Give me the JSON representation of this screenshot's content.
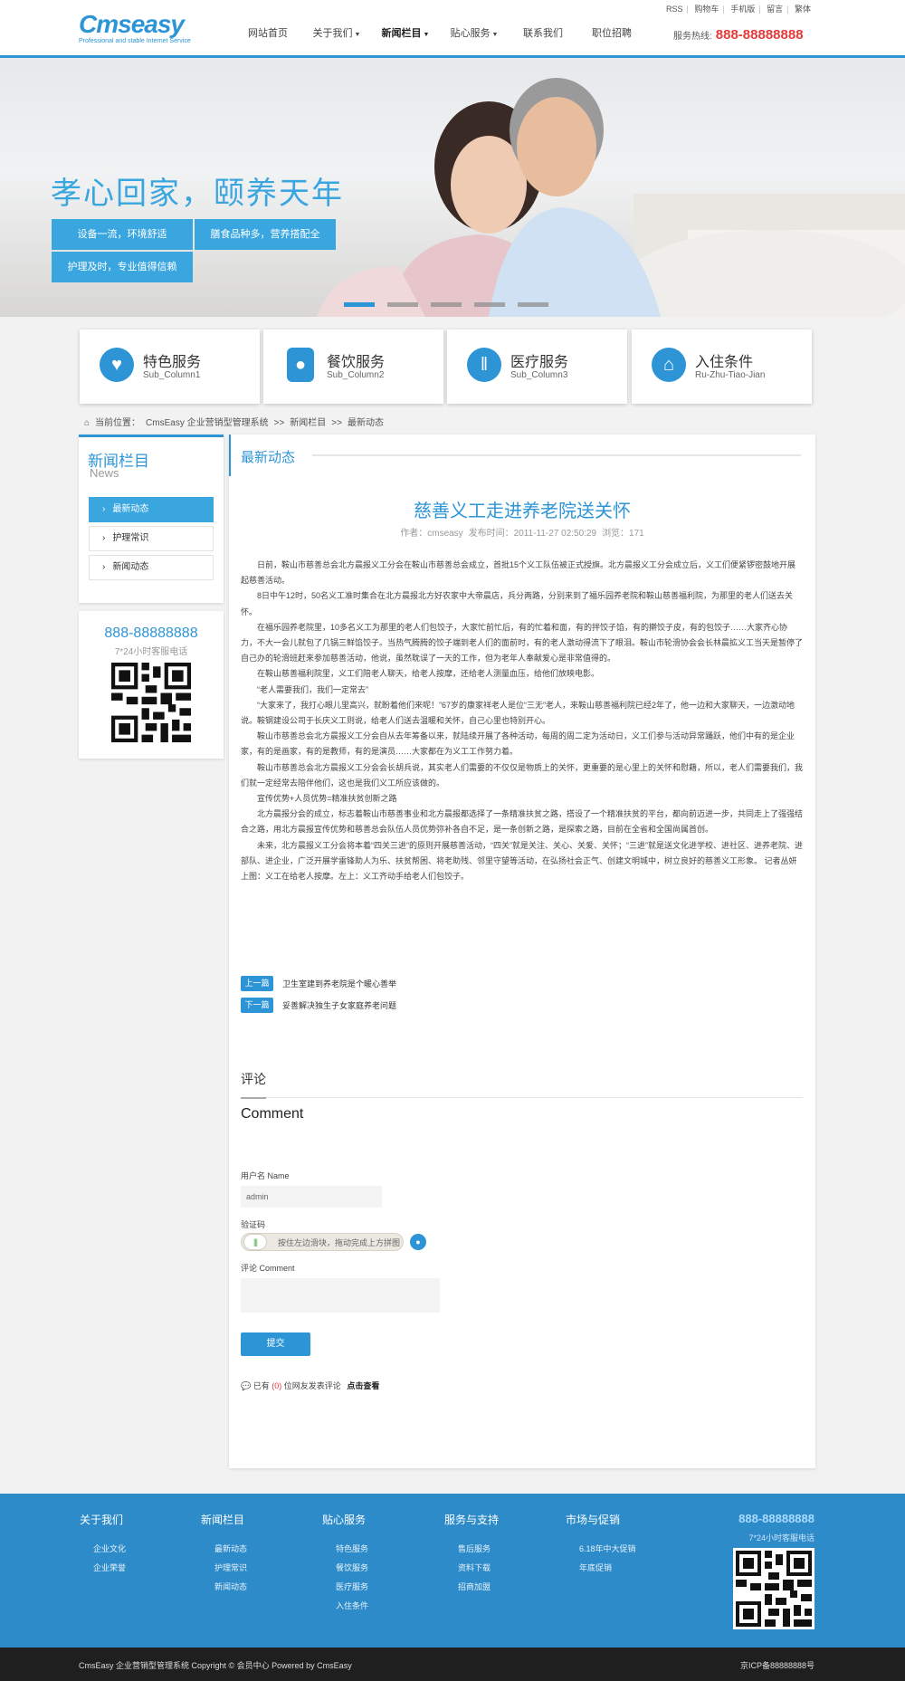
{
  "header": {
    "logo_text": "Cmseasy",
    "logo_sub": "Professional and stable Internet Service",
    "top_links": [
      "RSS",
      "购物车",
      "手机版",
      "留言",
      "繁体"
    ],
    "nav": [
      "网站首页",
      "关于我们",
      "新闻栏目",
      "贴心服务",
      "联系我们",
      "职位招聘"
    ],
    "hotline_label": "服务热线:",
    "hotline": "888-88888888"
  },
  "banner": {
    "title": "孝心回家，颐养天年",
    "boxes": [
      "设备一流，环境舒适",
      "膳食品种多，营养搭配全",
      "护理及时，专业值得信赖"
    ]
  },
  "services": [
    {
      "title": "特色服务",
      "sub": "Sub_Column1",
      "icon": "heart-icon"
    },
    {
      "title": "餐饮服务",
      "sub": "Sub_Column2",
      "icon": "bottle-icon"
    },
    {
      "title": "医疗服务",
      "sub": "Sub_Column3",
      "icon": "cutlery-icon"
    },
    {
      "title": "入住条件",
      "sub": "Ru-Zhu-Tiao-Jian",
      "icon": "home-icon"
    }
  ],
  "breadcrumb": {
    "label": "当前位置：",
    "items": [
      "CmsEasy 企业营销型管理系统",
      ">>",
      "新闻栏目",
      ">>",
      "最新动态"
    ]
  },
  "sidebar": {
    "title": "新闻栏目",
    "sub": "News",
    "items": [
      "最新动态",
      "护理常识",
      "新闻动态"
    ]
  },
  "contact": {
    "phone": "888-88888888",
    "label": "7*24小时客服电话"
  },
  "main": {
    "section_title": "最新动态",
    "article_title": "慈善义工走进养老院送关怀",
    "author": "作者：cmseasy",
    "time": "发布时间：2011-11-27 02:50:29",
    "views": "浏览：171",
    "paragraphs": [
      "日前，鞍山市慈善总会北方晨报义工分会在鞍山市慈善总会成立，首批15个义工队伍被正式授旗。北方晨报义工分会成立后，义工们便紧锣密鼓地开展起慈善活动。",
      "8日中午12时，50名义工准时集合在北方晨报北方好农家中大帝晨店，兵分两路，分别来到了福乐园养老院和鞍山慈善福利院，为那里的老人们送去关怀。",
      "在福乐园养老院里，10多名义工为那里的老人们包饺子，大家忙前忙后，有的忙着和面，有的拌饺子馅，有的擀饺子皮，有的包饺子……大家齐心协力，不大一会儿就包了几锅三鲜馅饺子。当热气腾腾的饺子端到老人们的面前时，有的老人激动得流下了眼泪。鞍山市轮滑协会会长林晨拡义工当天是暂停了自己办的轮滑班赶来参加慈善活动，他说，虽然耽误了一天的工作，但为老年人奉献爱心是非常值得的。",
      "在鞍山慈善福利院里，义工们陪老人聊天，给老人按摩，还给老人测量血压，给他们放映电影。",
      "“老人需要我们，我们一定常去”",
      "“大家来了，我打心眼儿里高兴，就盼着他们来呢！”67岁的康家祥老人是位“三无”老人，来鞍山慈善福利院已经2年了，他一边和大家聊天，一边激动地说。鞍钢建设公司于长庆义工则说，给老人们送去温暖和关怀，自己心里也特别开心。",
      "鞍山市慈善总会北方晨报义工分会自从去年筹备以来，就陆续开展了各种活动，每周的周二定为活动日，义工们参与活动异常踊跃，他们中有的是企业家，有的是画家，有的是教师，有的是演员……大家都在为义工工作努力着。",
      "鞍山市慈善总会北方晨报义工分会会长胡兵说，其实老人们需要的不仅仅是物质上的关怀，更重要的是心里上的关怀和慰藉，所以，老人们需要我们，我们就一定经常去陪伴他们，这也是我们义工所应该做的。",
      "宣传优势+人员优势=精准扶贫创新之路",
      "北方晨报分会的成立，标志着鞍山市慈善事业和北方晨报都选择了一条精准扶贫之路，搭设了一个精准扶贫的平台，都向前迈进一步，共同走上了强强结合之路，用北方晨报宣传优势和慈善总会队伍人员优势弥补各自不足，是一条创新之路，是探索之路，目前在全省和全国尚属首创。",
      "未来，北方晨报义工分会将本着“四关三进”的原则开展慈善活动，“四关”就是关注、关心、关爱、关怀；“三进”就是送文化进学校、进社区、进养老院、进部队、进企业，广泛开展学雷锋助人为乐、扶贫帮困、将老助残、邻里守望等活动，在弘扬社会正气、创建文明城中，树立良好的慈善义工形象。 记者丛妍上图：义工在给老人按摩。左上：义工齐动手给老人们包饺子。"
    ],
    "prev_label": "上一篇",
    "prev_title": "卫生室建到养老院是个暖心善举",
    "next_label": "下一篇",
    "next_title": "妥善解决独生子女家庭养老问题"
  },
  "comment": {
    "title": "评论",
    "title_en": "Comment",
    "username_label": "用户名 Name",
    "username_value": "admin",
    "captcha_label": "验证码",
    "slider_text": "按住左边滑块，拖动完成上方拼图",
    "comment_label": "评论 Comment",
    "submit": "提交",
    "count_prefix": "已有",
    "count": "(0)",
    "count_suffix": "位网友发表评论",
    "view_link": "点击查看"
  },
  "footer": {
    "columns": [
      {
        "title": "关于我们",
        "items": [
          "企业文化",
          "企业荣誉"
        ]
      },
      {
        "title": "新闻栏目",
        "items": [
          "最新动态",
          "护理常识",
          "新闻动态"
        ]
      },
      {
        "title": "贴心服务",
        "items": [
          "特色服务",
          "餐饮服务",
          "医疗服务",
          "入住条件"
        ]
      },
      {
        "title": "服务与支持",
        "items": [
          "售后服务",
          "资料下载",
          "招商加盟"
        ]
      },
      {
        "title": "市场与促销",
        "items": [
          "6.18年中大促销",
          "年底促销"
        ]
      }
    ],
    "phone": "888-88888888",
    "phone_label": "7*24小时客服电话",
    "copyright": "CmsEasy 企业营销型管理系统 Copyright © 会员中心 Powered by CmsEasy",
    "icp": "京ICP备88888888号"
  },
  "colors": {
    "accent": "#2d95d6",
    "hotline": "#e63a3a",
    "footer": "#2d8bc9"
  }
}
